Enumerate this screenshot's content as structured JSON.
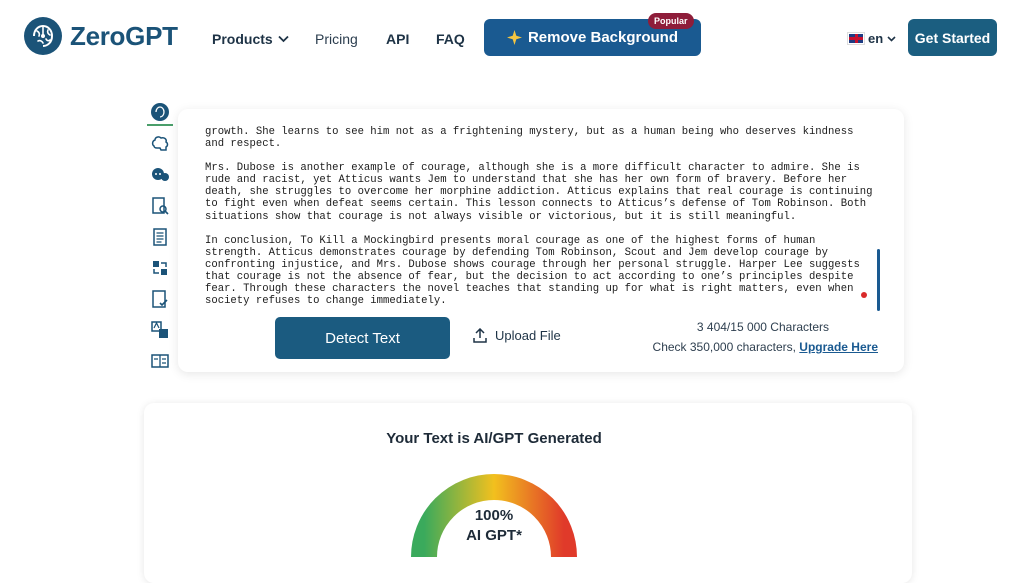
{
  "header": {
    "brand": "ZeroGPT",
    "nav": {
      "products": "Products",
      "pricing": "Pricing",
      "api": "API",
      "faq": "FAQ"
    },
    "remove_bg": "Remove Background",
    "popular_badge": "Popular",
    "language": "en",
    "get_started": "Get Started"
  },
  "tools": [
    "ai-detector-icon",
    "brain-icon",
    "chatbot-icon",
    "document-search-icon",
    "summarizer-icon",
    "paraphraser-icon",
    "grammar-check-icon",
    "translator-icon",
    "word-counter-icon"
  ],
  "editor": {
    "paragraphs": [
      "growth. She learns to see him not as a frightening mystery, but as a human being who deserves kindness and respect.",
      "Mrs. Dubose is another example of courage, although she is a more difficult character to admire. She is rude and racist, yet Atticus wants Jem to understand that she has her own form of bravery. Before her death, she struggles to overcome her morphine addiction. Atticus explains that real courage is continuing to fight even when defeat seems certain. This lesson connects to Atticus’s defense of Tom Robinson. Both situations show that courage is not always visible or victorious, but it is still meaningful.",
      "In conclusion, To Kill a Mockingbird presents moral courage as one of the highest forms of human strength. Atticus demonstrates courage by defending Tom Robinson, Scout and Jem develop courage by confronting injustice, and Mrs. Dubose shows courage through her personal struggle. Harper Lee suggests that courage is not the absence of fear, but the decision to act according to one’s principles despite fear. Through these characters the novel teaches that standing up for what is right matters, even when society refuses to change immediately."
    ],
    "detect_button": "Detect Text",
    "upload_button": "Upload File",
    "char_count": "3 404/15 000 Characters",
    "check_text": "Check 350,000 characters,",
    "upgrade_link": "Upgrade Here"
  },
  "result": {
    "title": "Your Text is AI/GPT Generated",
    "percent": "100%",
    "label": "AI GPT*",
    "ai_fraction": 1.0
  },
  "colors": {
    "primary": "#1b5b80",
    "remove_bg": "#1a5a91",
    "badge": "#8e1d3a",
    "gauge_start": "#3aaa5c",
    "gauge_mid": "#f2c01e",
    "gauge_end": "#e03a2a"
  }
}
